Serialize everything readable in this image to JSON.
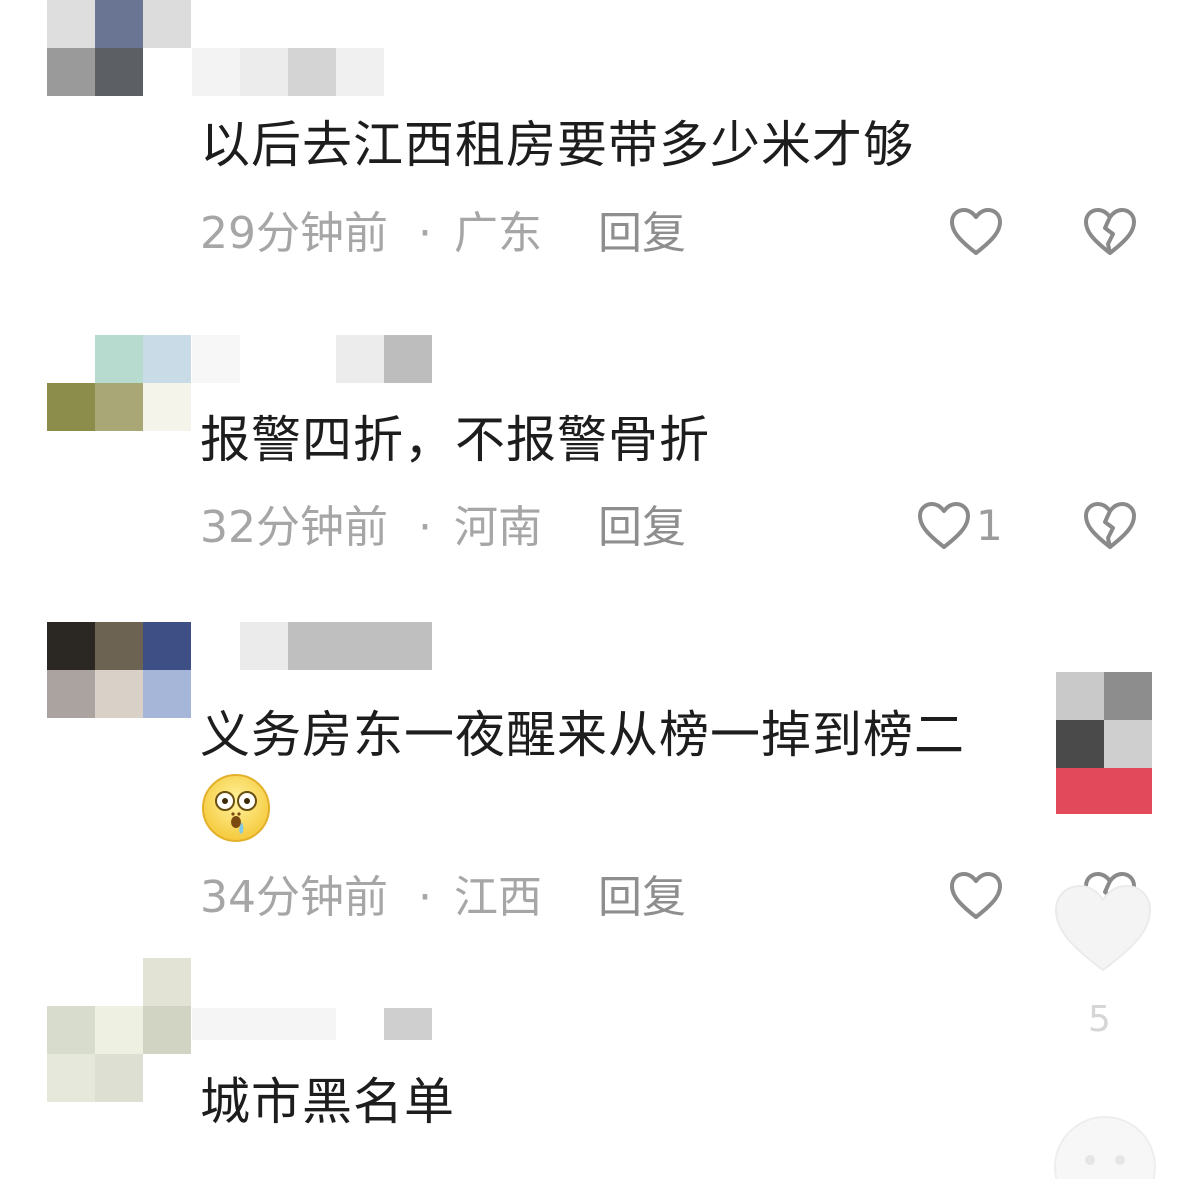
{
  "comments": [
    {
      "text": "以后去江西租房要带多少米才够",
      "time": "29分钟前",
      "location": "广东",
      "reply_label": "回复",
      "likes": "",
      "avatar_colors": [
        "#dedede",
        "#6a7594",
        "#dcdcdc",
        "#9a9a9a",
        "#5c5f63",
        "#ffffff"
      ],
      "name_colors": [
        "#f3f3f3",
        "#ececec",
        "#d4d4d4",
        "#f0f0f0"
      ]
    },
    {
      "text": "报警四折，不报警骨折",
      "time": "32分钟前",
      "location": "河南",
      "reply_label": "回复",
      "likes": "1",
      "avatar_colors": [
        "#ffffff",
        "#b7dccf",
        "#c9dbe7",
        "#8c8d4a",
        "#a8a775",
        "#f4f4ea"
      ],
      "name_colors": [
        "#f7f7f7",
        "#ececec",
        "#bdbdbd"
      ]
    },
    {
      "text": "义务房东一夜醒来从榜一掉到榜二",
      "time": "34分钟前",
      "location": "江西",
      "reply_label": "回复",
      "likes": "",
      "avatar_colors": [
        "#2b2722",
        "#6d6352",
        "#3e4f86",
        "#aaa39f",
        "#d9d1c8",
        "#a5b6d8"
      ],
      "name_colors": [
        "#ebebeb",
        "#bfbfbf"
      ]
    },
    {
      "text": "城市黑名单",
      "time": "",
      "location": "",
      "reply_label": "",
      "likes": "",
      "avatar_colors": [
        "#ffffff",
        "#e2e3d5",
        "#ffffff",
        "#d8dccd",
        "#eef1e2",
        "#d1d4c3"
      ],
      "name_colors": [
        "#f5f5f5",
        "#cfcfcf"
      ]
    }
  ],
  "side_overlay": {
    "badge_count": "5",
    "colors": [
      "#c9c9c9",
      "#8d8d8d",
      "#4a4a4a",
      "#cfcfcf",
      "#e24a5c"
    ]
  },
  "icons": {
    "like": "heart-outline-icon",
    "dislike": "broken-heart-icon",
    "emoji": "shocked-face-emoji"
  }
}
